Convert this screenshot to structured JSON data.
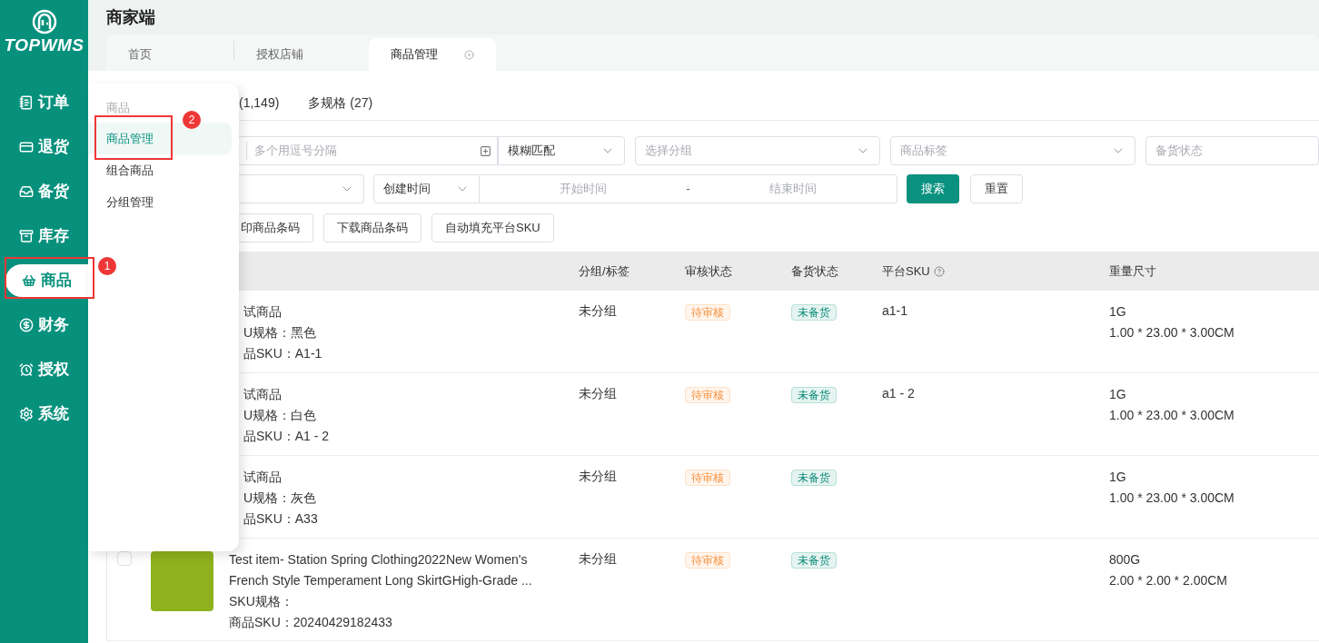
{
  "logo": {
    "text": "TOPWMS"
  },
  "sidebar": {
    "items": [
      {
        "label": "订单",
        "selected": false
      },
      {
        "label": "退货",
        "selected": false
      },
      {
        "label": "备货",
        "selected": false
      },
      {
        "label": "库存",
        "selected": false
      },
      {
        "label": "商品",
        "selected": true,
        "annotation": "1"
      },
      {
        "label": "财务",
        "selected": false
      },
      {
        "label": "授权",
        "selected": false
      },
      {
        "label": "系统",
        "selected": false
      }
    ]
  },
  "header": {
    "title": "商家端"
  },
  "page_tabs": [
    {
      "label": "首页",
      "selected": false
    },
    {
      "label": "授权店铺",
      "selected": false
    },
    {
      "label": "商品管理",
      "selected": true
    }
  ],
  "submenu": {
    "title": "商品",
    "items": [
      {
        "label": "商品管理",
        "selected": true,
        "annotation": "2"
      },
      {
        "label": "组合商品",
        "selected": false
      },
      {
        "label": "分组管理",
        "selected": false
      }
    ]
  },
  "count_tabs": [
    {
      "label": "(1,149)"
    },
    {
      "label": "多规格 (27)"
    }
  ],
  "filters": {
    "codes": {
      "placeholder": "多个用逗号分隔"
    },
    "match": {
      "value": "模糊匹配"
    },
    "group": {
      "placeholder": "选择分组"
    },
    "tag": {
      "placeholder": "商品标签"
    },
    "stock": {
      "placeholder": "备货状态"
    },
    "time_type": {
      "value": "创建时间"
    },
    "start": {
      "placeholder": "开始时间"
    },
    "separator": "-",
    "end": {
      "placeholder": "结束时间"
    },
    "search": "搜索",
    "reset": "重置"
  },
  "actions": [
    "印商品条码",
    "下载商品条码",
    "自动填充平台SKU"
  ],
  "table": {
    "columns": [
      "分组/标签",
      "审核状态",
      "备货状态",
      "平台SKU",
      "重量尺寸"
    ],
    "rows": [
      {
        "product": [
          "试商品",
          "U规格：黑色",
          "品SKU：A1-1"
        ],
        "group": "未分组",
        "audit": "待审核",
        "stock": "未备货",
        "platform_sku": "a1-1",
        "weight": "1G",
        "size": "1.00 * 23.00 * 3.00CM"
      },
      {
        "product": [
          "试商品",
          "U规格：白色",
          "品SKU：A1 - 2"
        ],
        "group": "未分组",
        "audit": "待审核",
        "stock": "未备货",
        "platform_sku": "a1 - 2",
        "weight": "1G",
        "size": "1.00 * 23.00 * 3.00CM"
      },
      {
        "product": [
          "试商品",
          "U规格：灰色",
          "品SKU：A33"
        ],
        "group": "未分组",
        "audit": "待审核",
        "stock": "未备货",
        "weight": "1G",
        "size": "1.00 * 23.00 * 3.00CM"
      },
      {
        "checkbox": {
          "checked": false
        },
        "image": true,
        "product": [
          "Test item- Station Spring Clothing2022New Women's",
          "French Style Temperament Long SkirtGHigh-Grade ...",
          "SKU规格：",
          "商品SKU：20240429182433"
        ],
        "group": "未分组",
        "audit": "待审核",
        "stock": "未备货",
        "weight": "800G",
        "size": "2.00 * 2.00 * 2.00CM"
      }
    ]
  }
}
